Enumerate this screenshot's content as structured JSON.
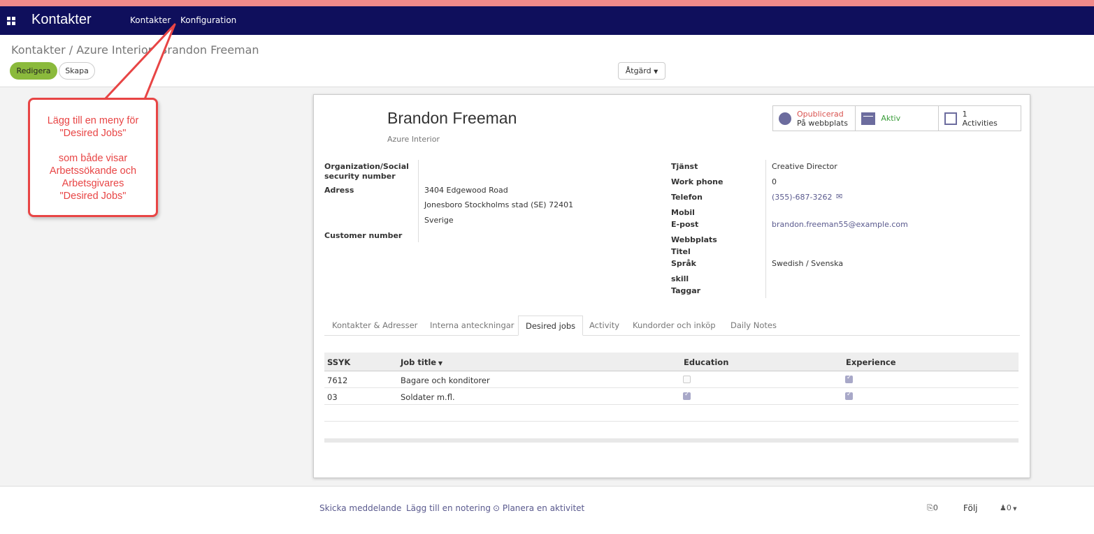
{
  "navbar": {
    "app_title": "Kontakter",
    "menu": [
      "Kontakter",
      "Konfiguration"
    ]
  },
  "control_panel": {
    "breadcrumb": "Kontakter / Azure Interior, Brandon Freeman",
    "edit_label": "Redigera",
    "create_label": "Skapa",
    "action_label": "Åtgärd"
  },
  "record": {
    "name": "Brandon Freeman",
    "company": "Azure Interior"
  },
  "smart_buttons": {
    "publish_status": "Opublicerad",
    "publish_sub": "På webbplats",
    "active_label": "Aktiv",
    "activities_count": "1",
    "activities_label": "Activities"
  },
  "left_fields": {
    "org_label": "Organization/Social security number",
    "address_label": "Adress",
    "address_line1": "3404 Edgewood Road",
    "address_line2": "Jonesboro  Stockholms stad (SE)  72401",
    "address_line3": "Sverige",
    "customer_number_label": "Customer number"
  },
  "right_fields": {
    "service_label": "Tjänst",
    "service_value": "Creative Director",
    "work_phone_label": "Work phone",
    "work_phone_value": "0",
    "phone_label": "Telefon",
    "phone_value": "(355)-687-3262",
    "mobile_label": "Mobil",
    "email_label": "E-post",
    "email_value": "brandon.freeman55@example.com",
    "website_label": "Webbplats",
    "title_label": "Titel",
    "language_label": "Språk",
    "language_value": "Swedish / Svenska",
    "skill_label": "skill",
    "tags_label": "Taggar"
  },
  "tabs": [
    "Kontakter & Adresser",
    "Interna anteckningar",
    "Desired jobs",
    "Activity",
    "Kundorder och inköp",
    "Daily Notes"
  ],
  "table": {
    "headers": [
      "SSYK",
      "Job title",
      "Education",
      "Experience"
    ],
    "rows": [
      {
        "ssyk": "7612",
        "job_title": "Bagare och konditorer",
        "education": false,
        "experience": true
      },
      {
        "ssyk": "03",
        "job_title": "Soldater m.fl.",
        "education": true,
        "experience": true
      }
    ]
  },
  "chatter": {
    "send_message": "Skicka meddelande",
    "log_note": "Lägg till en notering",
    "schedule_activity": "Planera en aktivitet",
    "attachments_count": "0",
    "follow_label": "Följ",
    "followers_count": "0"
  },
  "callout": {
    "line1": "Lägg till en meny för",
    "line2": "\"Desired Jobs\"",
    "line3": "som både visar",
    "line4": "Arbetssökande och",
    "line5": "Arbetsgivares",
    "line6": "\"Desired Jobs\""
  },
  "colors": {
    "navbar": "#0f0f5c",
    "primary_button": "#8bba3c",
    "callout": "#e84545",
    "link": "#5a5a8e"
  },
  "icons": [
    "apps-icon",
    "globe-icon",
    "archive-icon",
    "calendar-icon",
    "envelope-icon",
    "caret-down-icon",
    "clock-icon",
    "paperclip-icon",
    "user-icon"
  ]
}
